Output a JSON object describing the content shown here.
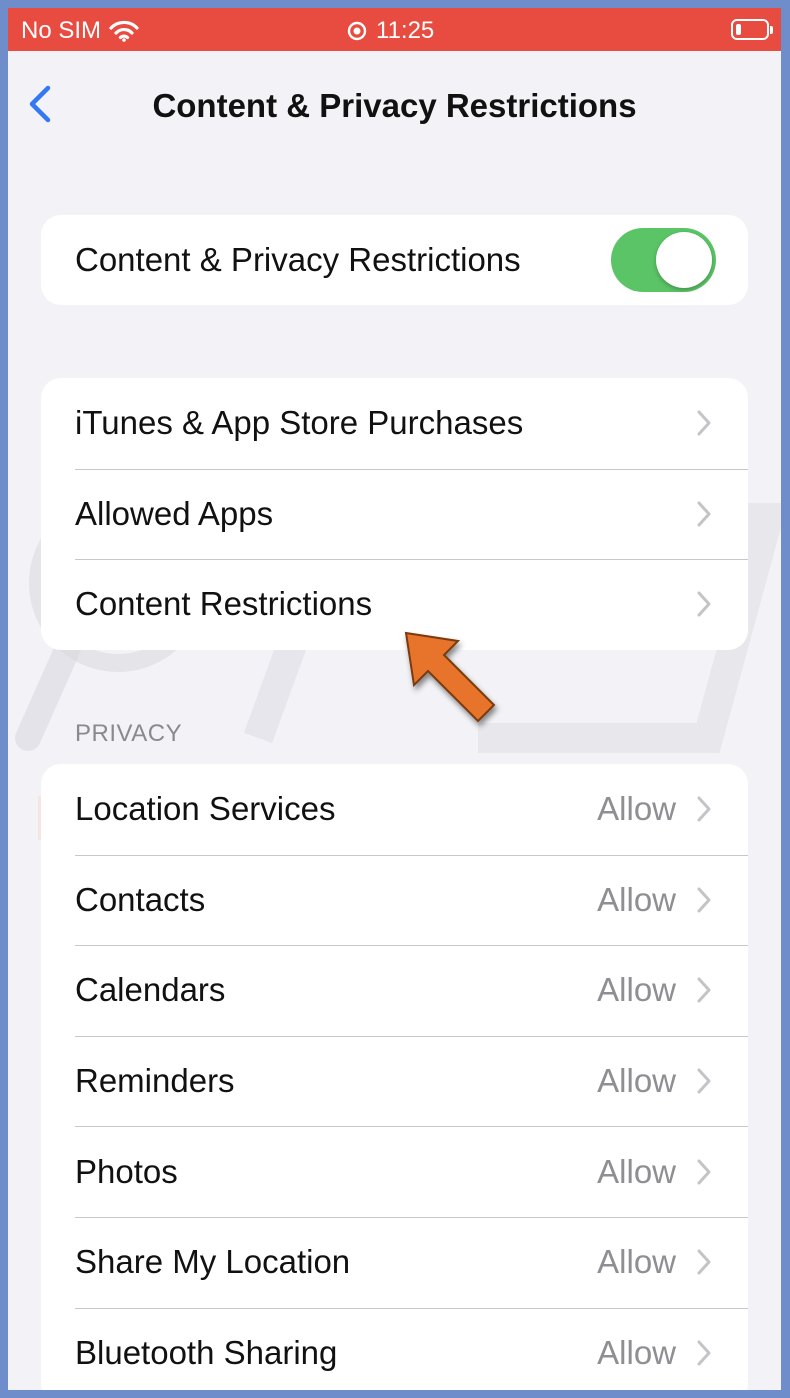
{
  "status_bar": {
    "carrier": "No SIM",
    "time": "11:25"
  },
  "nav": {
    "title": "Content & Privacy Restrictions"
  },
  "main_toggle": {
    "label": "Content & Privacy Restrictions",
    "on": true
  },
  "store_group": [
    {
      "label": "iTunes & App Store Purchases"
    },
    {
      "label": "Allowed Apps"
    },
    {
      "label": "Content Restrictions"
    }
  ],
  "privacy": {
    "header": "PRIVACY",
    "items": [
      {
        "label": "Location Services",
        "value": "Allow"
      },
      {
        "label": "Contacts",
        "value": "Allow"
      },
      {
        "label": "Calendars",
        "value": "Allow"
      },
      {
        "label": "Reminders",
        "value": "Allow"
      },
      {
        "label": "Photos",
        "value": "Allow"
      },
      {
        "label": "Share My Location",
        "value": "Allow"
      },
      {
        "label": "Bluetooth Sharing",
        "value": "Allow"
      }
    ]
  },
  "colors": {
    "status_bar": "#e84b3f",
    "toggle_on": "#5ac466",
    "accent": "#3478f6",
    "arrow": "#e8732c"
  }
}
